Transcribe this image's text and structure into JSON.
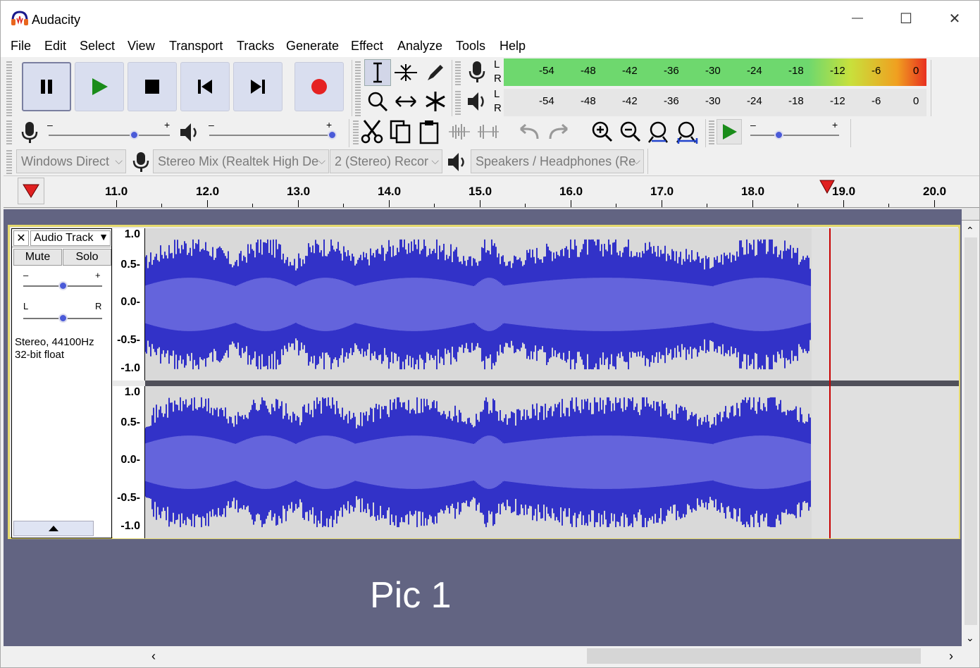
{
  "window": {
    "title": "Audacity",
    "minimize": "—",
    "maximize": "☐",
    "close": "✕"
  },
  "menu": [
    "File",
    "Edit",
    "Select",
    "View",
    "Transport",
    "Tracks",
    "Generate",
    "Effect",
    "Analyze",
    "Tools",
    "Help"
  ],
  "meters": {
    "record": {
      "L": "L",
      "R": "R",
      "scale": [
        "-54",
        "-48",
        "-42",
        "-36",
        "-30",
        "-24",
        "-18",
        "-12",
        "-6",
        "0"
      ]
    },
    "playback": {
      "L": "L",
      "R": "R",
      "scale": [
        "-54",
        "-48",
        "-42",
        "-36",
        "-30",
        "-24",
        "-18",
        "-12",
        "-6",
        "0"
      ]
    }
  },
  "device": {
    "host": "Windows Direct",
    "recording_device": "Stereo Mix (Realtek High De",
    "channels": "2 (Stereo) Recor",
    "playback_device": "Speakers / Headphones (Re"
  },
  "ruler": [
    "11.0",
    "12.0",
    "13.0",
    "14.0",
    "15.0",
    "16.0",
    "17.0",
    "18.0",
    "19.0",
    "20.0"
  ],
  "track": {
    "name": "Audio Track",
    "mute": "Mute",
    "solo": "Solo",
    "gain_minus": "–",
    "gain_plus": "+",
    "pan_left": "L",
    "pan_right": "R",
    "info_line1": "Stereo, 44100Hz",
    "info_line2": "32-bit float",
    "scale": [
      "1.0",
      "0.5-",
      "0.0-",
      "-0.5-",
      "-1.0"
    ]
  },
  "overlay_label": "Pic 1",
  "colors": {
    "wave_dark": "#3232c8",
    "wave_light": "#6464dc",
    "track_bg": "#626482",
    "selected_border": "#e5d96e",
    "play_head": "#c80000"
  }
}
